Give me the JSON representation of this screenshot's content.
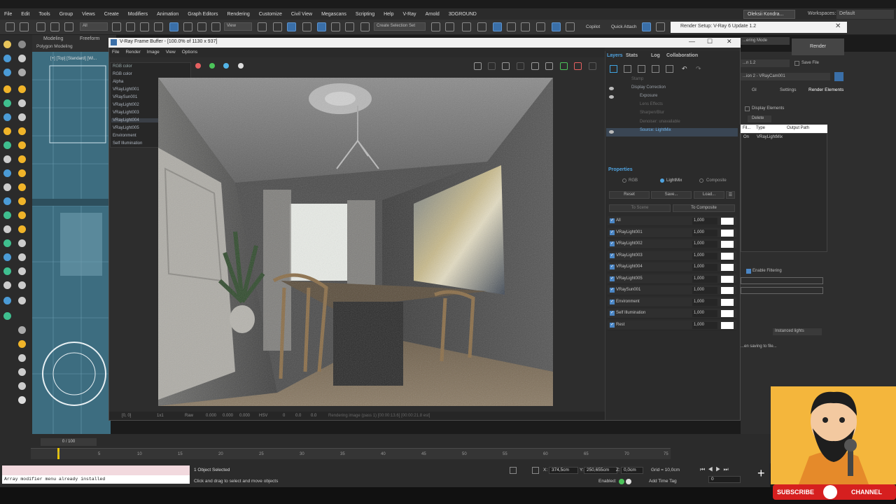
{
  "menubar": {
    "items": [
      "File",
      "Edit",
      "Tools",
      "Group",
      "Views",
      "Create",
      "Modifiers",
      "Animation",
      "Graph Editors",
      "Rendering",
      "Customize",
      "Civil View",
      "Megascans",
      "Scripting",
      "Help",
      "V-Ray",
      "Arnold",
      "3DGROUND"
    ],
    "user": "Oleksii Kondra...",
    "workspaces_label": "Workspaces:",
    "workspaces_value": "Default"
  },
  "toolbar": {
    "filter_value": "All",
    "view_value": "View",
    "selection_set": "Create Selection Set",
    "copilot": "Copilot",
    "quick_attach": "Quick Attach"
  },
  "ribbon": {
    "tabs": [
      "Modeling",
      "Freeform"
    ],
    "subtitle": "Polygon Modeling"
  },
  "viewport": {
    "label": "[+] [Top] [Standard] [Wi..."
  },
  "vfb": {
    "title": "V-Ray Frame Buffer - [100.0% of 1130 x 937]",
    "menu": [
      "File",
      "Render",
      "Image",
      "View",
      "Options"
    ],
    "channel_selected": "RGB color",
    "channels": [
      "RGB color",
      "Alpha",
      "VRayLight001",
      "VRaySun001",
      "VRayLight002",
      "VRayLight003",
      "VRayLight004",
      "VRayLight005",
      "Environment",
      "Self Illumination"
    ],
    "dot_colors": [
      "#e46060",
      "#4cc45a",
      "#53b5e8"
    ],
    "status": {
      "coords": "[0, 0]",
      "ratio": "1x1",
      "mode": "Raw",
      "v1": "0.000",
      "v2": "0.000",
      "v3": "0.000",
      "space": "HSV",
      "v4": "0",
      "v5": "0.0",
      "v6": "0.0",
      "progress": "Rendering image (pass 1) [00:00:13.6] [00:00:21.8 est]"
    }
  },
  "layers": {
    "tabs": [
      "Layers",
      "Stats",
      "Log",
      "Collaboration"
    ],
    "rows": [
      "Stamp",
      "Display Correction",
      "Exposure",
      "Lens Effects",
      "Sharpen/Blur",
      "Denoiser: unavailable",
      "Source: LightMix"
    ],
    "properties_title": "Properties",
    "modes": [
      "RGB",
      "LightMix",
      "Composite"
    ],
    "buttons": [
      "Reset",
      "Save...",
      "Load...",
      "To Scene",
      "To Composite"
    ],
    "lightmix": [
      {
        "name": "All",
        "value": "1,000"
      },
      {
        "name": "VRayLight001",
        "value": "1,000"
      },
      {
        "name": "VRayLight002",
        "value": "1,000"
      },
      {
        "name": "VRayLight003",
        "value": "1,000"
      },
      {
        "name": "VRayLight004",
        "value": "1,000"
      },
      {
        "name": "VRayLight005",
        "value": "1,000"
      },
      {
        "name": "VRaySun001",
        "value": "1,000"
      },
      {
        "name": "Environment",
        "value": "1,000"
      },
      {
        "name": "Self Illumination",
        "value": "1,000"
      },
      {
        "name": "Rest",
        "value": "1,000"
      }
    ]
  },
  "render_setup": {
    "title": "Render Setup: V-Ray 6 Update 1.2",
    "mode": "...ering Mode",
    "render_label": "Render",
    "version": "...n 1.2",
    "save_file": "Save File",
    "camera": "...ion 2 - VRayCam001",
    "tabs": [
      "GI",
      "Settings",
      "Render Elements"
    ],
    "display_elements": "Display Elements",
    "delete": "Delete",
    "table_headers": [
      "Fil...",
      "Type",
      "Output Path"
    ],
    "table_row": [
      "On",
      "VRayLightMix"
    ],
    "enable_filtering": "Enable Filtering",
    "instanced": "Instanced lights",
    "saving": "...en saving to file..."
  },
  "timeline": {
    "frame": "0 / 100",
    "ticks": [
      "0",
      "5",
      "10",
      "15",
      "20",
      "25",
      "30",
      "35",
      "40",
      "45",
      "50",
      "55",
      "60",
      "65",
      "70",
      "75"
    ]
  },
  "status": {
    "script_output": "Array modifier menu already installed",
    "selected": "1 Object Selected",
    "hint": "Click and drag to select and move objects",
    "x": "374,5cm",
    "y": "250,655cm",
    "z": "0,0cm",
    "grid": "Grid = 10,0cm",
    "enabled": "Enabled:",
    "add_time_tag": "Add Time Tag"
  },
  "subscribe": {
    "left": "SUBSCRIBE",
    "right": "CHANNEL"
  }
}
